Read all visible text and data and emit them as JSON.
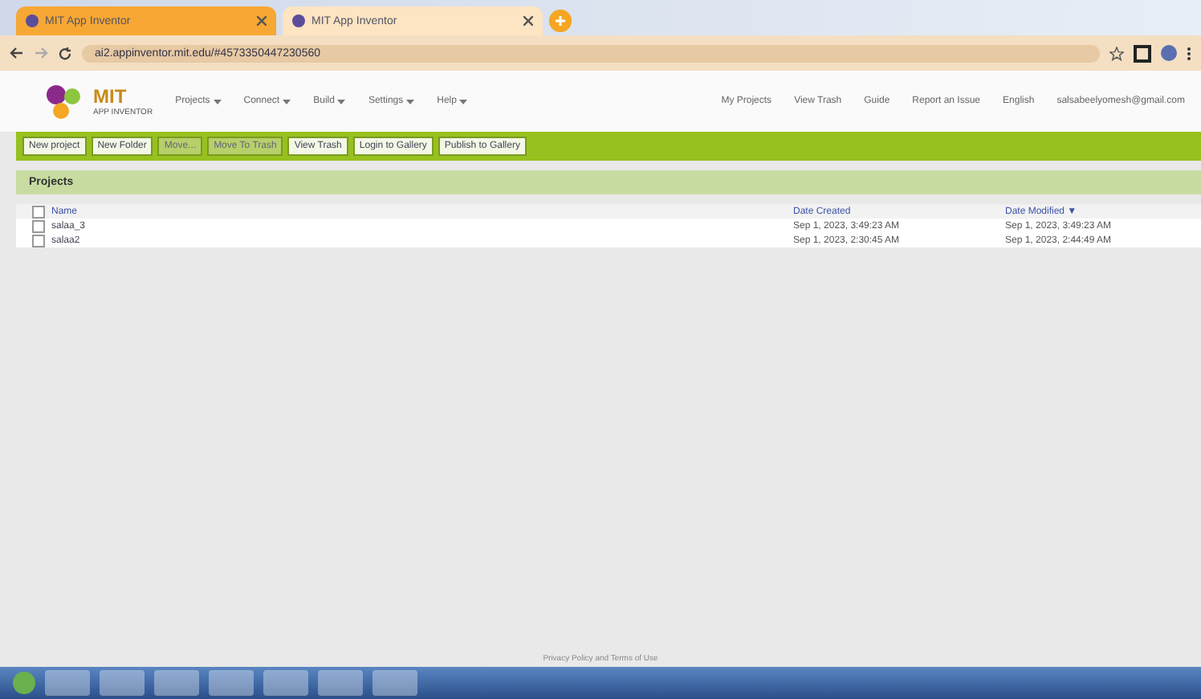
{
  "browser": {
    "tabs": [
      {
        "title": "MIT App Inventor",
        "selected": true
      },
      {
        "title": "MIT App Inventor",
        "selected": false
      }
    ],
    "url": "ai2.appinventor.mit.edu/#4573350447230560"
  },
  "header": {
    "logo_title": "MIT",
    "logo_subtitle": "APP INVENTOR",
    "menus": [
      "Projects",
      "Connect",
      "Build",
      "Settings",
      "Help"
    ],
    "links": [
      "My Projects",
      "View Trash",
      "Guide",
      "Report an Issue",
      "English",
      "salsabeelyomesh@gmail.com"
    ]
  },
  "toolbar": [
    {
      "label": "New project",
      "disabled": false
    },
    {
      "label": "New Folder",
      "disabled": false
    },
    {
      "label": "Move...",
      "disabled": true
    },
    {
      "label": "Move To Trash",
      "disabled": true
    },
    {
      "label": "View Trash",
      "disabled": false
    },
    {
      "label": "Login to Gallery",
      "disabled": false
    },
    {
      "label": "Publish to Gallery",
      "disabled": false
    }
  ],
  "projects": {
    "title": "Projects",
    "all_checked": false,
    "columns": [
      "Name",
      "Date Created",
      "Date Modified ▼"
    ],
    "rows": [
      {
        "cells": [
          "salaa_3",
          "Sep 1, 2023, 3:49:23 AM",
          "Sep 1, 2023, 3:49:23 AM"
        ],
        "checked": false
      },
      {
        "cells": [
          "salaa2",
          "Sep 1, 2023, 2:30:45 AM",
          "Sep 1, 2023, 2:44:49 AM"
        ],
        "checked": false
      }
    ]
  },
  "footer": "Privacy Policy and Terms of Use"
}
